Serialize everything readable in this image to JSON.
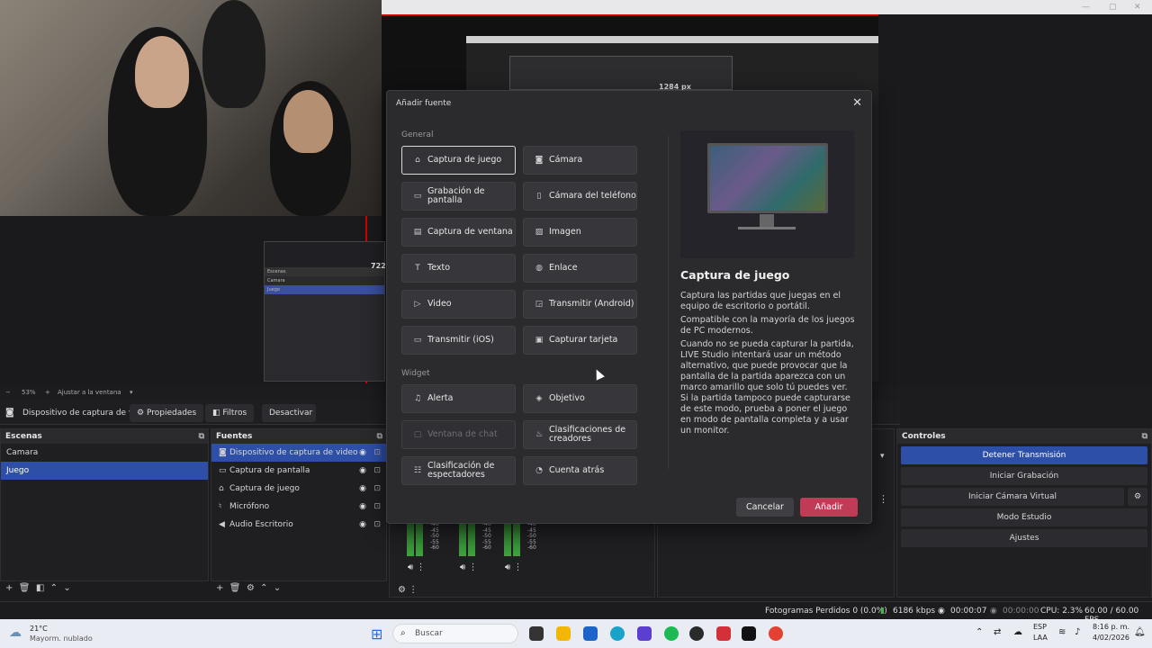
{
  "preview": {
    "nested_px_label": "1284 px",
    "nested_px_label2": "722",
    "zoom": "53%",
    "fit_label": "Ajustar a la ventana",
    "mini_rows": [
      "Escenas",
      "Camara",
      "Juego"
    ]
  },
  "source_toolbar": {
    "current_source": "Dispositivo de captura de v",
    "properties": "Propiedades",
    "filters": "Filtros",
    "deactivate": "Desactivar"
  },
  "scenes": {
    "title": "Escenas",
    "items": [
      {
        "label": "Camara",
        "selected": false
      },
      {
        "label": "Juego",
        "selected": true
      }
    ]
  },
  "sources": {
    "title": "Fuentes",
    "items": [
      {
        "label": "Dispositivo de captura de video",
        "icon": "camera-icon",
        "selected": true
      },
      {
        "label": "Captura de pantalla",
        "icon": "monitor-icon",
        "selected": false
      },
      {
        "label": "Captura de juego",
        "icon": "gamepad-icon",
        "selected": false
      },
      {
        "label": "Micrófono",
        "icon": "microphone-icon",
        "selected": false
      },
      {
        "label": "Audio Escritorio",
        "icon": "speaker-icon",
        "selected": false
      }
    ]
  },
  "mixer": {
    "scale": [
      "-40",
      "-45",
      "-50",
      "-55",
      "-60"
    ]
  },
  "controls": {
    "title": "Controles",
    "stop_stream": "Detener Transmisión",
    "start_record": "Iniciar Grabación",
    "start_vcam": "Iniciar Cámara Virtual",
    "studio_mode": "Modo Estudio",
    "settings": "Ajustes"
  },
  "status": {
    "dropped": "Fotogramas Perdidos 0 (0.0%)",
    "bitrate": "6186 kbps",
    "stream_time": "00:00:07",
    "rec_time": "00:00:00",
    "cpu": "CPU: 2.3%",
    "fps": "60.00 / 60.00 FPS"
  },
  "taskbar": {
    "weather_temp": "21°C",
    "weather_desc": "Mayorm. nublado",
    "search": "Buscar",
    "lang": "ESP",
    "lang2": "LAA",
    "time": "8:16 p. m.",
    "date": "4/02/2026"
  },
  "dialog": {
    "title": "Añadir fuente",
    "general_label": "General",
    "widget_label": "Widget",
    "general_options": [
      {
        "label": "Captura de juego",
        "icon": "gamepad-icon",
        "selected": true,
        "disabled": false
      },
      {
        "label": "Cámara",
        "icon": "camera-icon",
        "selected": false,
        "disabled": false
      },
      {
        "label": "Grabación de pantalla",
        "icon": "monitor-icon",
        "selected": false,
        "disabled": false
      },
      {
        "label": "Cámara del teléfono",
        "icon": "phone-icon",
        "selected": false,
        "disabled": false
      },
      {
        "label": "Captura de ventana",
        "icon": "window-icon",
        "selected": false,
        "disabled": false
      },
      {
        "label": "Imagen",
        "icon": "image-icon",
        "selected": false,
        "disabled": false
      },
      {
        "label": "Texto",
        "icon": "text-icon",
        "selected": false,
        "disabled": false
      },
      {
        "label": "Enlace",
        "icon": "globe-icon",
        "selected": false,
        "disabled": false
      },
      {
        "label": "Video",
        "icon": "play-icon",
        "selected": false,
        "disabled": false
      },
      {
        "label": "Transmitir (Android)",
        "icon": "cast-icon",
        "selected": false,
        "disabled": false
      },
      {
        "label": "Transmitir (iOS)",
        "icon": "display-icon",
        "selected": false,
        "disabled": false
      },
      {
        "label": "Capturar tarjeta",
        "icon": "video-icon",
        "selected": false,
        "disabled": false
      }
    ],
    "widget_options": [
      {
        "label": "Alerta",
        "icon": "bell-icon",
        "selected": false,
        "disabled": false
      },
      {
        "label": "Objetivo",
        "icon": "shield-icon",
        "selected": false,
        "disabled": false
      },
      {
        "label": "Ventana de chat",
        "icon": "chat-icon",
        "selected": false,
        "disabled": true
      },
      {
        "label": "Clasificaciones de creadores",
        "icon": "flame-icon",
        "selected": false,
        "disabled": false
      },
      {
        "label": "Clasificación de espectadores",
        "icon": "ranking-icon",
        "selected": false,
        "disabled": false
      },
      {
        "label": "Cuenta atrás",
        "icon": "timer-icon",
        "selected": false,
        "disabled": false
      }
    ],
    "detail_title": "Captura de juego",
    "detail_p1": "Captura las partidas que juegas en el equipo de escritorio o portátil.",
    "detail_p2": "Compatible con la mayoría de los juegos de PC modernos.",
    "detail_p3": "Cuando no se pueda capturar la partida, LIVE Studio intentará usar un método alternativo, que puede provocar que la pantalla de la partida aparezca con un marco amarillo que solo tú puedes ver. Si la partida tampoco puede capturarse de este modo, prueba a poner el juego en modo de pantalla completa y a usar un monitor.",
    "cancel": "Cancelar",
    "add": "Añadir"
  }
}
